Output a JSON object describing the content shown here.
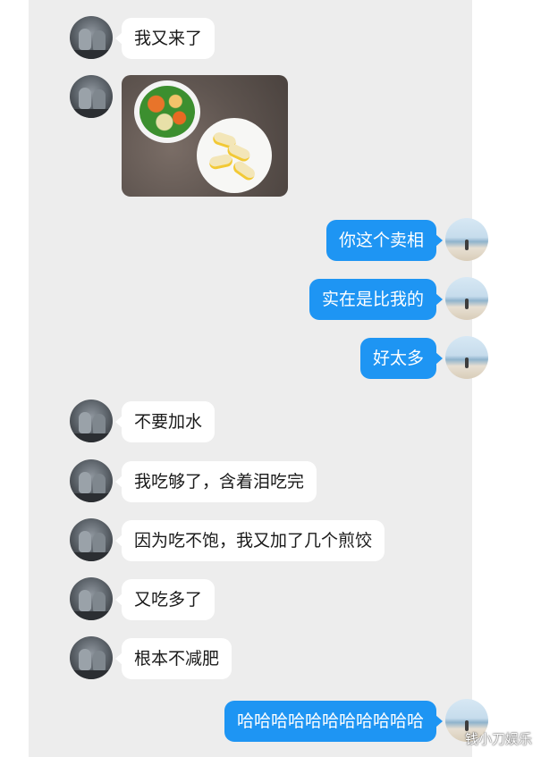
{
  "messages": [
    {
      "side": "left",
      "type": "text",
      "text": "我又来了"
    },
    {
      "side": "left",
      "type": "image",
      "image": "food-photo: bowl of stir-fried vegetables and plate of dumplings"
    },
    {
      "side": "right",
      "type": "text",
      "text": "你这个卖相"
    },
    {
      "side": "right",
      "type": "text",
      "text": "实在是比我的"
    },
    {
      "side": "right",
      "type": "text",
      "text": "好太多"
    },
    {
      "side": "left",
      "type": "text",
      "text": "不要加水"
    },
    {
      "side": "left",
      "type": "text",
      "text": "我吃够了，含着泪吃完"
    },
    {
      "side": "left",
      "type": "text",
      "text": "因为吃不饱，我又加了几个煎饺"
    },
    {
      "side": "left",
      "type": "text",
      "text": "又吃多了"
    },
    {
      "side": "left",
      "type": "text",
      "text": "根本不减肥"
    },
    {
      "side": "right",
      "type": "text",
      "text": "哈哈哈哈哈哈哈哈哈哈哈"
    }
  ],
  "watermark": "钱小刀娱乐",
  "colors": {
    "sent_bubble": "#1e95f3",
    "received_bubble": "#ffffff",
    "chat_background": "#ededed"
  }
}
